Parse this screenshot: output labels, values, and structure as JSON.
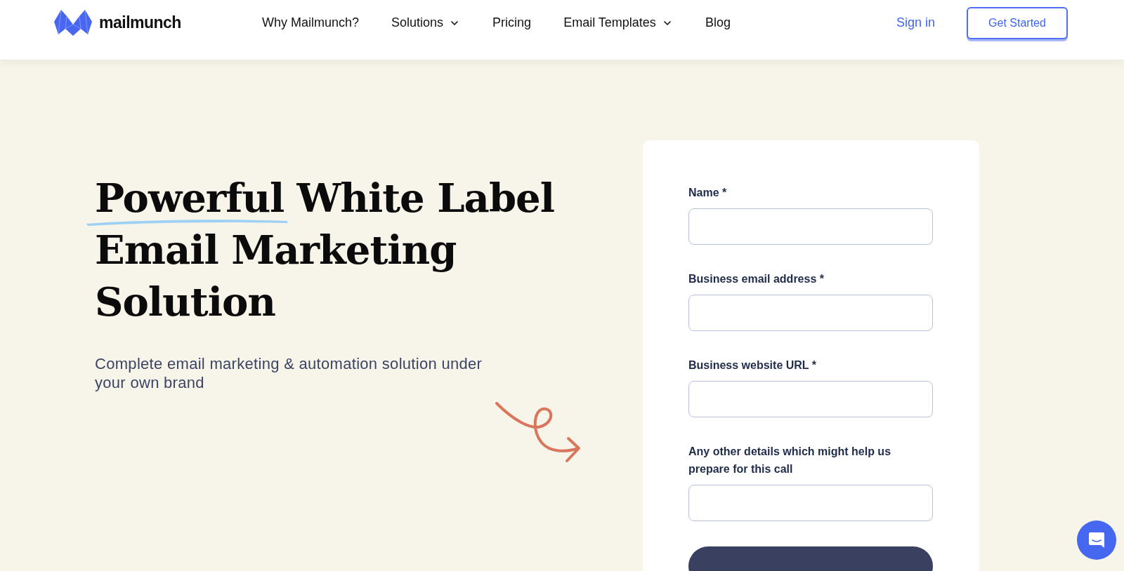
{
  "header": {
    "logo_text": "mailmunch",
    "nav": [
      {
        "label": "Why Mailmunch?",
        "dropdown": false
      },
      {
        "label": "Solutions",
        "dropdown": true
      },
      {
        "label": "Pricing",
        "dropdown": false
      },
      {
        "label": "Email Templates",
        "dropdown": true
      },
      {
        "label": "Blog",
        "dropdown": false
      }
    ],
    "sign_in": "Sign in",
    "cta": "Get Started"
  },
  "hero": {
    "title_lines": [
      [
        {
          "text": "Powerful",
          "underlined": true
        },
        {
          "text": "White Label",
          "underlined": false
        }
      ],
      [
        {
          "text": "Email Marketing",
          "underlined": false
        }
      ],
      [
        {
          "text": "Solution",
          "underlined": false
        }
      ]
    ],
    "subtitle": "Complete email marketing & automation solution under your own brand"
  },
  "form": {
    "fields": [
      {
        "label": "Name *"
      },
      {
        "label": "Business email address *"
      },
      {
        "label": "Business website URL *"
      },
      {
        "label": "Any other details which might help us prepare for this call"
      }
    ]
  }
}
